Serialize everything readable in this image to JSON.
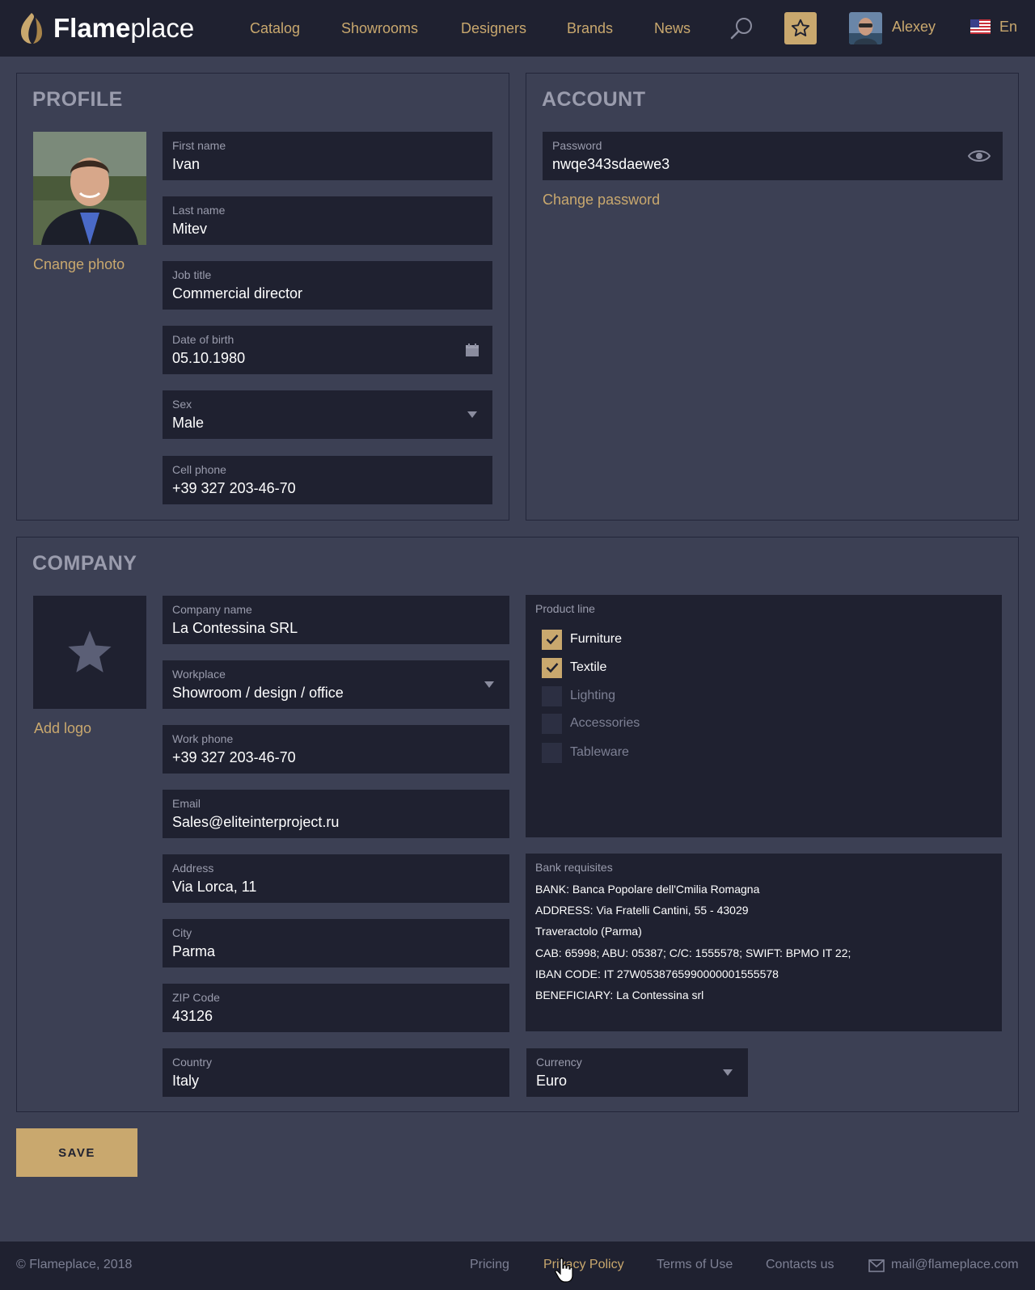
{
  "header": {
    "logo_bold": "Flame",
    "logo_light": "place",
    "nav": [
      "Catalog",
      "Showrooms",
      "Designers",
      "Brands",
      "News"
    ],
    "user_name": "Alexey",
    "language": "En"
  },
  "profile": {
    "title": "PROFILE",
    "change_photo": "Cnange photo",
    "first_name": {
      "label": "First name",
      "value": "Ivan"
    },
    "last_name": {
      "label": "Last name",
      "value": "Mitev"
    },
    "job_title": {
      "label": "Job title",
      "value": "Commercial director"
    },
    "dob": {
      "label": "Date of birth",
      "value": "05.10.1980"
    },
    "sex": {
      "label": "Sex",
      "value": "Male"
    },
    "cell_phone": {
      "label": "Cell phone",
      "value": "+39 327 203-46-70"
    }
  },
  "account": {
    "title": "ACCOUNT",
    "password": {
      "label": "Password",
      "value": "nwqe343sdaewe3"
    },
    "change_password": "Change password"
  },
  "company": {
    "title": "COMPANY",
    "add_logo": "Add logo",
    "company_name": {
      "label": "Company name",
      "value": "La Contessina SRL"
    },
    "workplace": {
      "label": "Workplace",
      "value": "Showroom / design / office"
    },
    "work_phone": {
      "label": "Work phone",
      "value": "+39 327 203-46-70"
    },
    "email": {
      "label": "Email",
      "value": "Sales@eliteinterproject.ru"
    },
    "address": {
      "label": "Address",
      "value": "Via Lorca, 11"
    },
    "city": {
      "label": "City",
      "value": "Parma"
    },
    "zip": {
      "label": "ZIP Code",
      "value": "43126"
    },
    "country": {
      "label": "Country",
      "value": "Italy"
    },
    "product_line": {
      "label": "Product line",
      "items": [
        {
          "label": "Furniture",
          "checked": true
        },
        {
          "label": "Textile",
          "checked": true
        },
        {
          "label": "Lighting",
          "checked": false
        },
        {
          "label": "Accessories",
          "checked": false
        },
        {
          "label": "Tableware",
          "checked": false
        }
      ]
    },
    "bank": {
      "label": "Bank requisites",
      "lines": [
        "BANK: Banca Popolare dell'Cmilia Romagna",
        "ADDRESS: Via Fratelli Cantini, 55 - 43029",
        "Traveractolo (Parma)",
        "CAB: 65998; ABU: 05387; C/C: 1555578; SWIFT: BPMO IT 22;",
        "IBAN CODE: IT 27W0538765990000001555578",
        "BENEFICIARY: La Contessina srl"
      ]
    },
    "currency": {
      "label": "Currency",
      "value": "Euro"
    }
  },
  "save_label": "SAVE",
  "footer": {
    "copyright": "© Flameplace, 2018",
    "links": [
      "Pricing",
      "Privacy Policy",
      "Terms of Use",
      "Contacts us"
    ],
    "email": "mail@flameplace.com"
  },
  "colors": {
    "accent": "#c9a86e",
    "background": "#3c4054",
    "field": "#1f2130"
  }
}
